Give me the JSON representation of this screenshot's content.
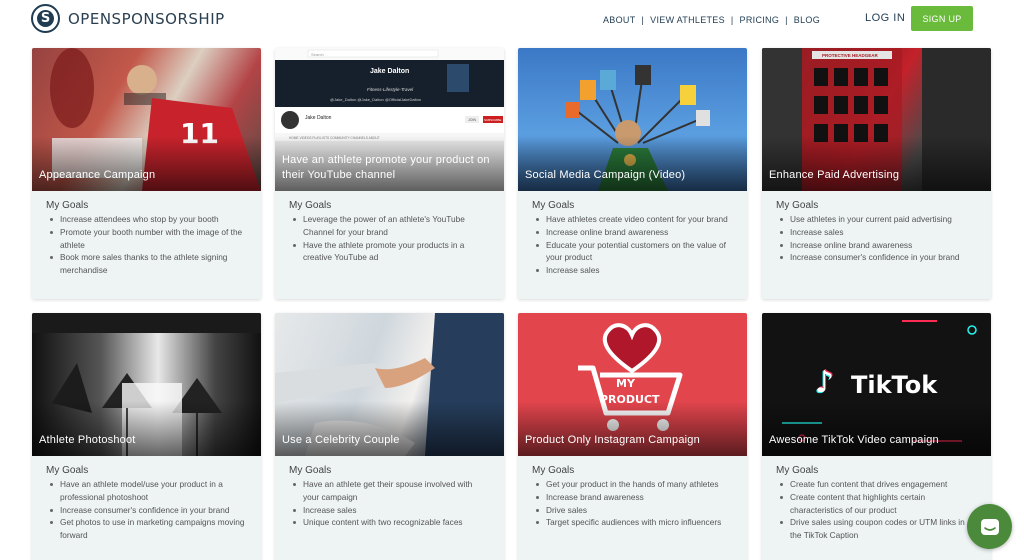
{
  "header": {
    "logo_text": "OPENSPONSORSHIP",
    "nav": [
      "ABOUT",
      "VIEW ATHLETES",
      "PRICING",
      "BLOG"
    ],
    "login_label": "LOG IN",
    "signup_label": "SIGN UP"
  },
  "colors": {
    "brand_navy": "#1f3c52",
    "signup_green": "#6abb3b",
    "card_bg": "#eef4f4",
    "chat_green": "#4a8a3a"
  },
  "cards": [
    {
      "title": "Appearance Campaign",
      "goals_heading": "My Goals",
      "goals": [
        "Increase attendees who stop by your booth",
        "Promote your booth number with the image of the athlete",
        "Book more sales thanks to the athlete signing merchandise"
      ]
    },
    {
      "title": "Have an athlete promote your product on their YouTube channel",
      "goals_heading": "My Goals",
      "goals": [
        "Leverage the power of an athlete's YouTube Channel for your brand",
        "Have the athlete promote your products in a creative YouTube ad"
      ],
      "screenshot": {
        "search": "Search",
        "banner_name": "Jake Dalton",
        "banner_sub": "Fitness-Lifestyle-Travel",
        "handles": [
          "@Jake_Dalton",
          "@Jake_Dalton",
          "@OfficialJakeDalton"
        ],
        "channel_name": "Jake Dalton",
        "tabs": [
          "HOME",
          "VIDEOS",
          "PLAYLISTS",
          "COMMUNITY",
          "CHANNELS",
          "ABOUT"
        ],
        "join": "JOIN",
        "subscribe": "SUBSCRIBE"
      }
    },
    {
      "title": "Social Media Campaign (Video)",
      "goals_heading": "My Goals",
      "goals": [
        "Have athletes create video content for your brand",
        "Increase online brand awareness",
        "Educate your potential customers on the value of your product",
        "Increase sales"
      ]
    },
    {
      "title": "Enhance Paid Advertising",
      "goals_heading": "My Goals",
      "goals": [
        "Use athletes in your current paid advertising",
        "Increase sales",
        "Increase online brand awareness",
        "Increase consumer's confidence in your brand"
      ],
      "sign_text": "PROTECTIVE HEADGEAR"
    },
    {
      "title": "Athlete Photoshoot",
      "goals_heading": "My Goals",
      "goals": [
        "Have an athlete model/use your product in a professional photoshoot",
        "Increase consumer's confidence in your brand",
        "Get photos to use in marketing campaigns moving forward"
      ]
    },
    {
      "title": "Use a Celebrity Couple",
      "goals_heading": "My Goals",
      "goals": [
        "Have an athlete get their spouse involved with your campaign",
        "Increase sales",
        "Unique content with two recognizable faces"
      ]
    },
    {
      "title": "Product Only Instagram Campaign",
      "goals_heading": "My Goals",
      "goals": [
        "Get your product in the hands of many athletes",
        "Increase brand awareness",
        "Drive sales",
        "Target specific audiences with micro influencers"
      ],
      "art_text": [
        "MY",
        "PRODUCT"
      ]
    },
    {
      "title": "Awesome TikTok Video campaign",
      "goals_heading": "My Goals",
      "goals": [
        "Create fun content that drives engagement",
        "Create content that highlights certain characteristics of our product",
        "Drive sales using coupon codes or UTM links in the TikTok Caption"
      ],
      "logo_text": "TikTok"
    }
  ]
}
